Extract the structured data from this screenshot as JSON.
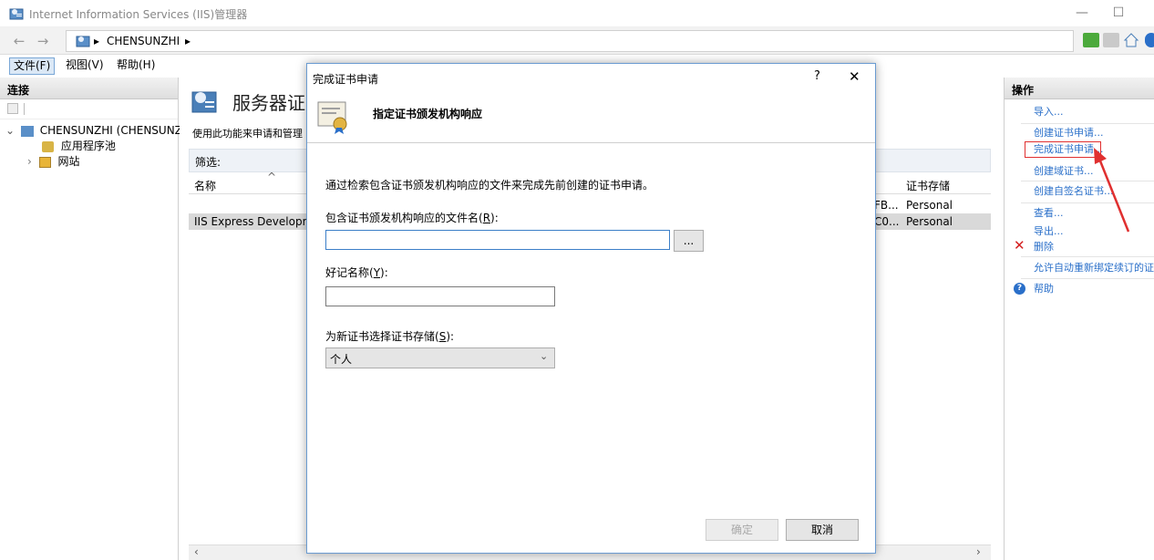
{
  "window": {
    "title": "Internet Information Services (IIS)管理器",
    "minimize": "—",
    "maximize": "☐"
  },
  "address": {
    "back": "←",
    "forward": "→",
    "arrow1": "▸",
    "server": "CHENSUNZHI",
    "arrow2": "▸"
  },
  "menu": {
    "file": "文件(F)",
    "view": "视图(V)",
    "help": "帮助(H)"
  },
  "left": {
    "header": "连接",
    "server_node": "CHENSUNZHI (CHENSUNZ",
    "app_pools": "应用程序池",
    "sites": "网站"
  },
  "center": {
    "title": "服务器证书",
    "description": "使用此功能来申请和管理",
    "filter_label": "筛选:",
    "col_name": "名称",
    "col_store": "证书存储",
    "rows": [
      {
        "name": "",
        "hash": "FB...",
        "store": "Personal"
      },
      {
        "name": "IIS Express Developme",
        "hash": "C0...",
        "store": "Personal"
      }
    ]
  },
  "right": {
    "header": "操作",
    "actions": {
      "import": "导入...",
      "create_request": "创建证书申请...",
      "complete_request": "完成证书申请...",
      "create_domain": "创建域证书...",
      "create_selfsigned": "创建自签名证书...",
      "view": "查看...",
      "export": "导出...",
      "delete": "删除",
      "auto_rebind": "允许自动重新绑定续订的证",
      "help": "帮助"
    }
  },
  "dialog": {
    "title": "完成证书申请",
    "help_btn": "?",
    "close_btn": "✕",
    "header": "指定证书颁发机构响应",
    "instruction": "通过检索包含证书颁发机构响应的文件来完成先前创建的证书申请。",
    "file_label": "包含证书颁发机构响应的文件名",
    "file_key": "(R)",
    "file_key_letter": "R",
    "file_value": "",
    "browse_btn": "...",
    "friendly_label": "好记名称",
    "friendly_key_letter": "Y",
    "friendly_value": "",
    "store_label": "为新证书选择证书存储",
    "store_key_letter": "S",
    "store_value": "个人",
    "ok_btn": "确定",
    "cancel_btn": "取消"
  },
  "colors": {
    "link": "#2a6fc9",
    "highlight_box": "#e03030",
    "dialog_border": "#6a9bd1"
  }
}
